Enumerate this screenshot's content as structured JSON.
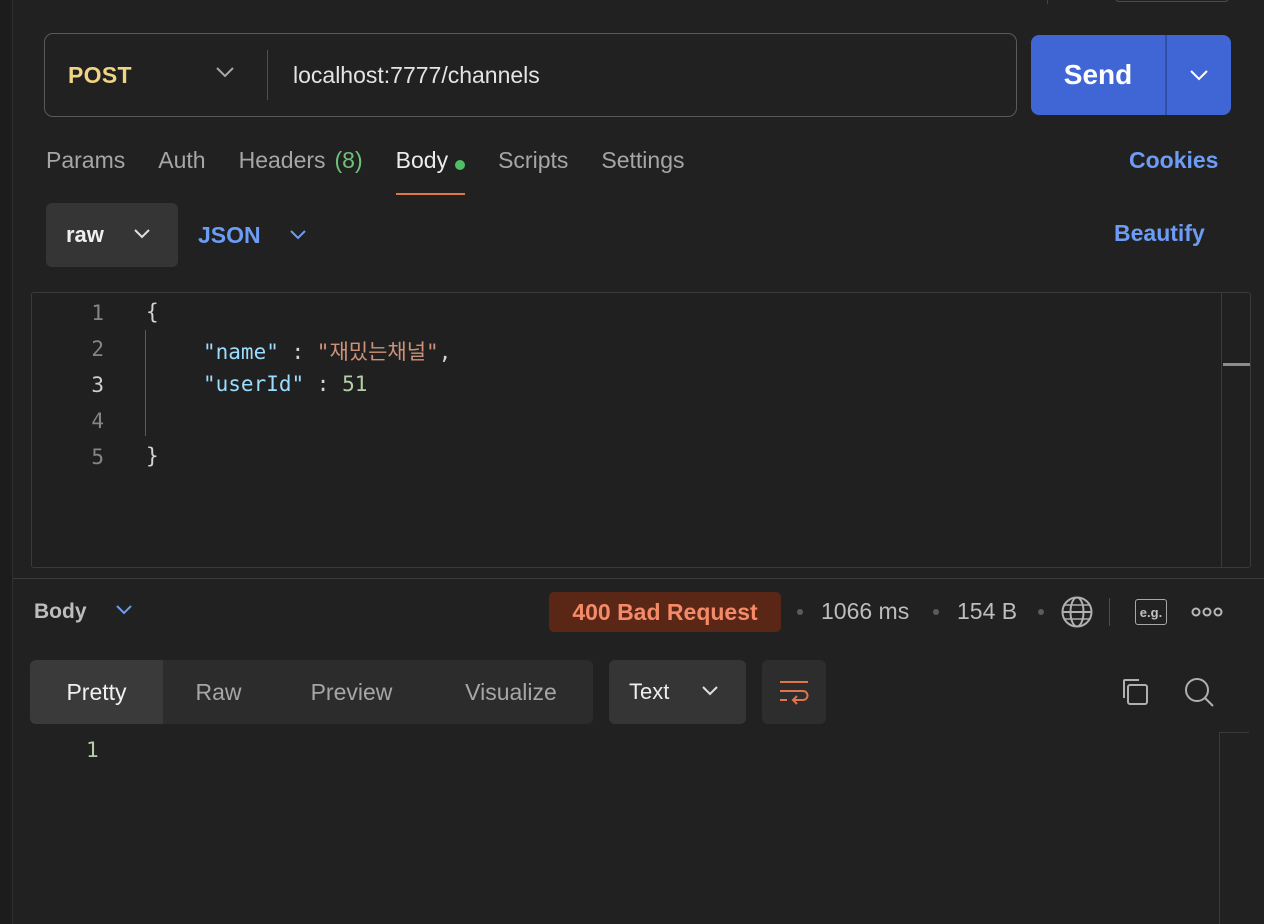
{
  "request": {
    "method": "POST",
    "url": "localhost:7777/channels",
    "send_label": "Send"
  },
  "tabs": [
    {
      "label": "Params"
    },
    {
      "label": "Auth"
    },
    {
      "label": "Headers",
      "count": "(8)"
    },
    {
      "label": "Body",
      "active": true,
      "indicator": "green-dot"
    },
    {
      "label": "Scripts"
    },
    {
      "label": "Settings"
    }
  ],
  "cookies_label": "Cookies",
  "body_toolbar": {
    "mode": "raw",
    "format": "JSON",
    "beautify_label": "Beautify"
  },
  "editor": {
    "line_numbers": [
      "1",
      "2",
      "3",
      "4",
      "5"
    ],
    "lines": {
      "l1": "{",
      "l2_key": "\"name\"",
      "l2_sep": " : ",
      "l2_val": "\"재밌는채널\"",
      "l2_end": ",",
      "l3_key": "\"userId\"",
      "l3_sep": " : ",
      "l3_val": "51",
      "l5": "}"
    }
  },
  "response": {
    "section_label": "Body",
    "status": "400 Bad Request",
    "time": "1066 ms",
    "size": "154 B",
    "example_label": "e.g.",
    "view_tabs": [
      {
        "label": "Pretty",
        "active": true
      },
      {
        "label": "Raw"
      },
      {
        "label": "Preview"
      },
      {
        "label": "Visualize"
      }
    ],
    "format": "Text",
    "line_numbers": [
      "1"
    ]
  },
  "colors": {
    "accent_blue": "#3f66d4",
    "link_blue": "#6d9cf5",
    "method_yellow": "#f0d483",
    "status_error": "#f58a68",
    "active_tab_underline": "#e0744b"
  },
  "icons": [
    "chevron-down-icon",
    "globe-icon",
    "example-icon",
    "more-icon",
    "wrap-icon",
    "copy-icon",
    "search-icon"
  ]
}
